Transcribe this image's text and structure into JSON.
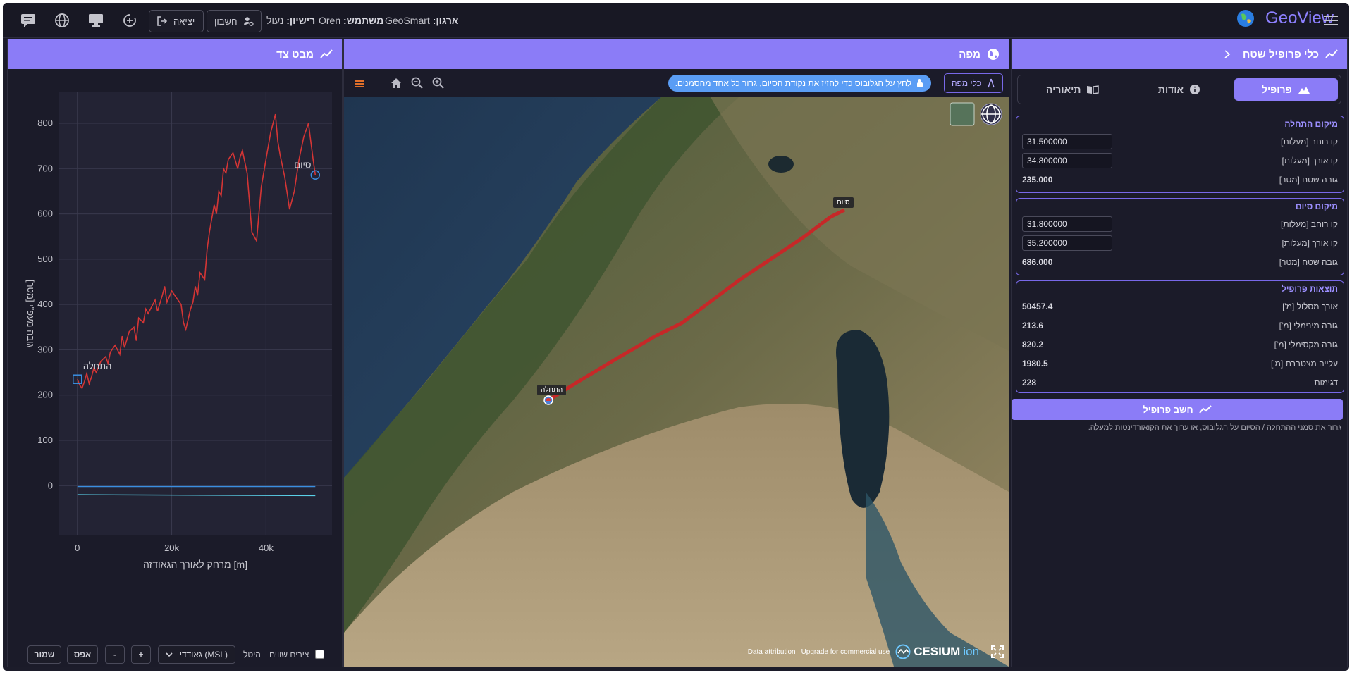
{
  "app": {
    "brand": "GeoView"
  },
  "topbar": {
    "org_label": "ארגון:",
    "org_value": "GeoSmart",
    "user_label": "משתמש:",
    "user_value": "Oren",
    "license_label": "רישיון:",
    "license_value": "נעול",
    "account_btn": "חשבון",
    "logout_btn": "יציאה"
  },
  "tool_panel": {
    "title": "כלי פרופיל שטח",
    "tabs": [
      {
        "label": "פרופיל",
        "active": true
      },
      {
        "label": "אודות",
        "active": false
      },
      {
        "label": "תיאוריה",
        "active": false
      }
    ],
    "start": {
      "title": "מיקום התחלה",
      "lat_label": "קו רוחב [מעלות]",
      "lat": "31.500000",
      "lon_label": "קו אורך [מעלות]",
      "lon": "34.800000",
      "height_label": "גובה שטח [מטר]",
      "height": "235.000"
    },
    "end": {
      "title": "מיקום סיום",
      "lat_label": "קו רוחב [מעלות]",
      "lat": "31.800000",
      "lon_label": "קו אורך [מעלות]",
      "lon": "35.200000",
      "height_label": "גובה שטח [מטר]",
      "height": "686.000"
    },
    "results": {
      "title": "תוצאות פרופיל",
      "rows": [
        {
          "label": "אורך מסלול [מ']",
          "value": "50457.4"
        },
        {
          "label": "גובה מינימלי [מ']",
          "value": "213.6"
        },
        {
          "label": "גובה מקסימלי [מ']",
          "value": "820.2"
        },
        {
          "label": "עלייה מצטברת [מ']",
          "value": "1980.5"
        },
        {
          "label": "דגימות",
          "value": "228"
        }
      ]
    },
    "compute_btn": "חשב פרופיל",
    "hint": "גרור את סמני ההתחלה / הסיום על הגלובוס, או ערוך את הקואורדינטות למעלה."
  },
  "map_panel": {
    "title": "מפה",
    "tools_btn": "כלי מפה",
    "hint": "לחץ על הגלובוס כדי להזיז את נקודת הסיום, גרור כל אחד מהסמנים.",
    "start_label": "התחלה",
    "end_label": "סיום",
    "data_attribution": "Data attribution",
    "upgrade": "Upgrade for commercial use",
    "cesium": "CESIUM",
    "ion": "ion"
  },
  "profile_panel": {
    "title": "מבט צד",
    "controls": {
      "save": "שמור",
      "reset": "אפס",
      "minus": "-",
      "plus": "+",
      "projection_select": "גאודדי (MSL)",
      "projection_label": "היטל",
      "equal_axes": "צירים שווים"
    }
  },
  "chart_data": {
    "type": "line",
    "xlabel": "מרחק לאורך הגאודזה [m]",
    "ylabel": "גובה מעפ\"י [מטר]",
    "xlim": [
      -4000,
      54000
    ],
    "ylim": [
      -110,
      870
    ],
    "x_ticks": [
      0,
      20000,
      40000
    ],
    "x_tick_labels": [
      "0",
      "20k",
      "40k"
    ],
    "y_ticks": [
      0,
      100,
      200,
      300,
      400,
      500,
      600,
      700,
      800
    ],
    "grid": true,
    "annotations": [
      {
        "text": "התחלה",
        "x": 0,
        "y": 235
      },
      {
        "text": "סיום",
        "x": 50457,
        "y": 686
      }
    ],
    "series": [
      {
        "color": "#d43535",
        "x": [
          0,
          500,
          1000,
          1500,
          2000,
          2500,
          3000,
          3500,
          4000,
          5000,
          6000,
          6500,
          7000,
          8000,
          9000,
          9500,
          10000,
          11000,
          12000,
          12500,
          13000,
          14000,
          14500,
          15000,
          16000,
          16500,
          17000,
          18000,
          18500,
          19000,
          20000,
          21000,
          22000,
          22500,
          23000,
          24000,
          24500,
          25000,
          25500,
          26000,
          27000,
          27500,
          28000,
          29000,
          29500,
          30000,
          30500,
          31000,
          31500,
          32000,
          33000,
          34000,
          34500,
          35000,
          36000,
          37000,
          38000,
          38500,
          39000,
          40000,
          41000,
          42000,
          42500,
          43000,
          44000,
          45000,
          46000,
          47000,
          48000,
          49000,
          50000,
          50457
        ],
        "y": [
          235,
          222,
          215,
          230,
          248,
          225,
          240,
          260,
          250,
          275,
          285,
          270,
          295,
          310,
          290,
          330,
          305,
          340,
          350,
          320,
          370,
          360,
          390,
          380,
          400,
          410,
          385,
          420,
          440,
          405,
          430,
          415,
          400,
          360,
          345,
          390,
          405,
          440,
          420,
          470,
          455,
          520,
          560,
          620,
          600,
          650,
          640,
          700,
          690,
          720,
          735,
          700,
          725,
          740,
          690,
          560,
          540,
          600,
          660,
          720,
          780,
          820,
          760,
          730,
          680,
          610,
          650,
          720,
          770,
          800,
          720,
          686
        ]
      },
      {
        "color": "#3a8ee0",
        "x": [
          0,
          50457
        ],
        "y": [
          -2,
          -2
        ]
      },
      {
        "color": "#5ad0e8",
        "x": [
          0,
          50457
        ],
        "y": [
          -20,
          -22
        ]
      }
    ]
  }
}
